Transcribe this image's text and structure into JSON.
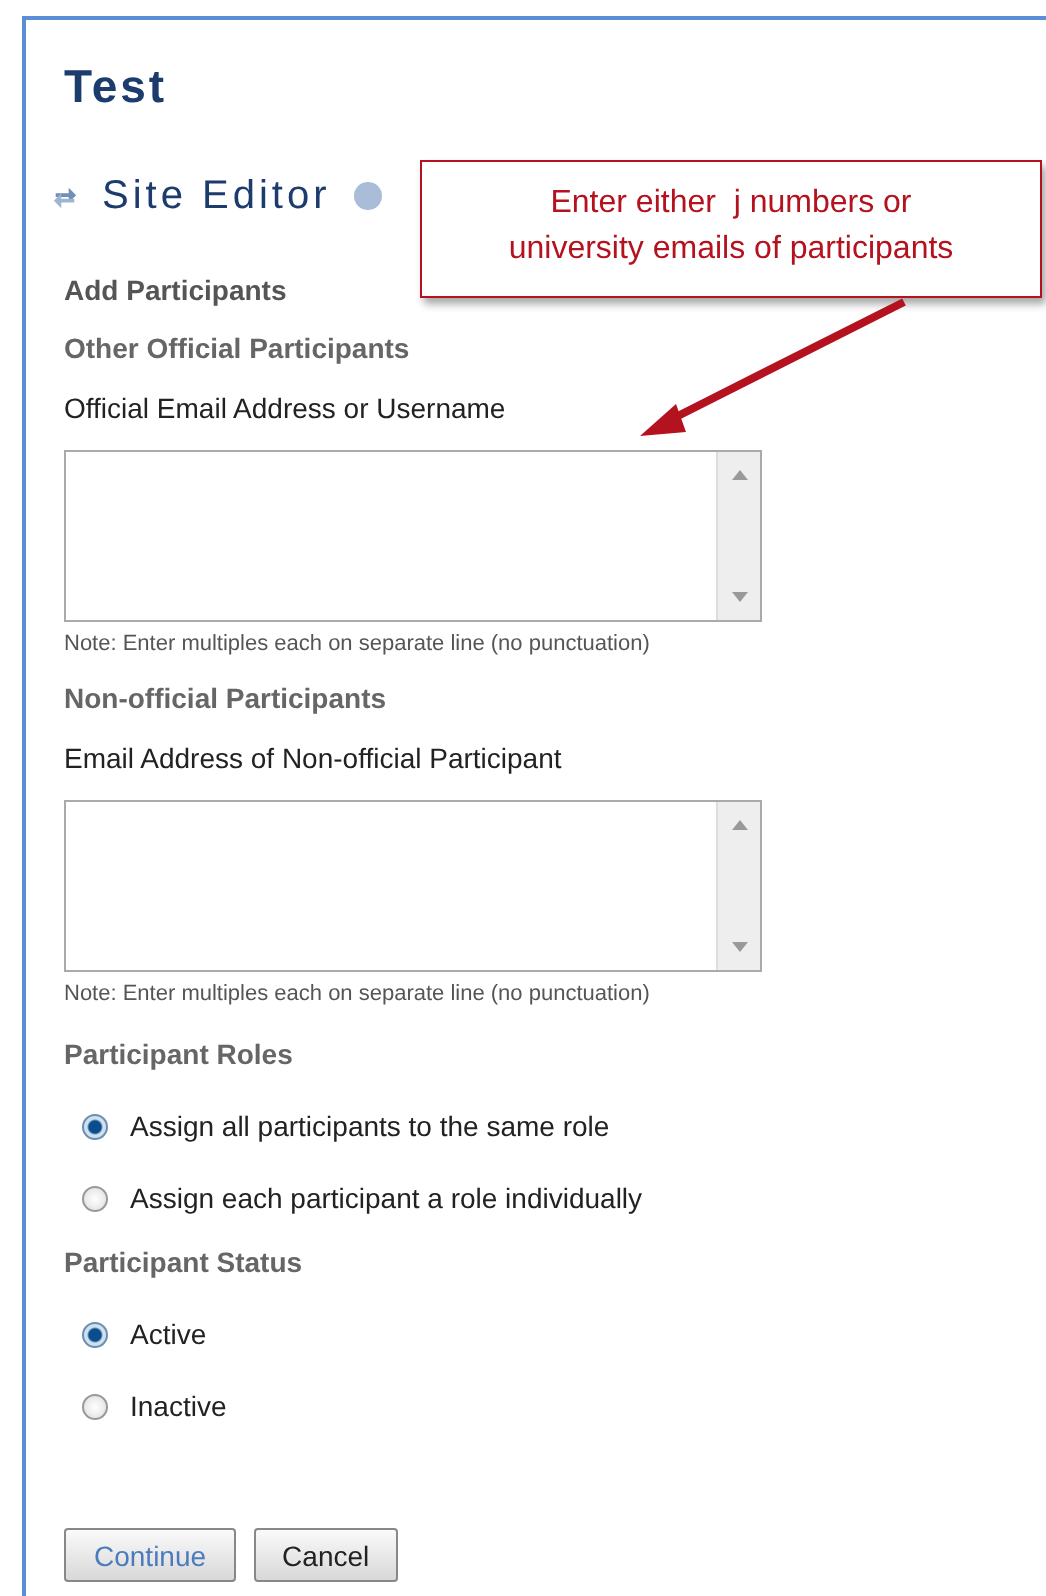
{
  "page_title": "Test",
  "tool_title": "Site Editor",
  "heading": "Add Participants",
  "sections": [
    {
      "title": "Other Official Participants",
      "field_label": "Official Email Address or Username",
      "note": "Note: Enter multiples each on separate line (no punctuation)"
    },
    {
      "title": "Non-official Participants",
      "field_label": "Email Address of Non-official Participant",
      "note": "Note: Enter multiples each on separate line (no punctuation)"
    }
  ],
  "radio_groups": [
    {
      "title": "Participant Roles",
      "options": [
        {
          "label": "Assign all participants to the same role",
          "selected": true
        },
        {
          "label": "Assign each participant a role individually",
          "selected": false
        }
      ]
    },
    {
      "title": "Participant Status",
      "options": [
        {
          "label": "Active",
          "selected": true
        },
        {
          "label": "Inactive",
          "selected": false
        }
      ]
    }
  ],
  "buttons": [
    {
      "label": "Continue",
      "kind": "primary"
    },
    {
      "label": "Cancel",
      "kind": "secondary"
    }
  ],
  "callout": {
    "text": "Enter either  j numbers or university emails of participants"
  }
}
